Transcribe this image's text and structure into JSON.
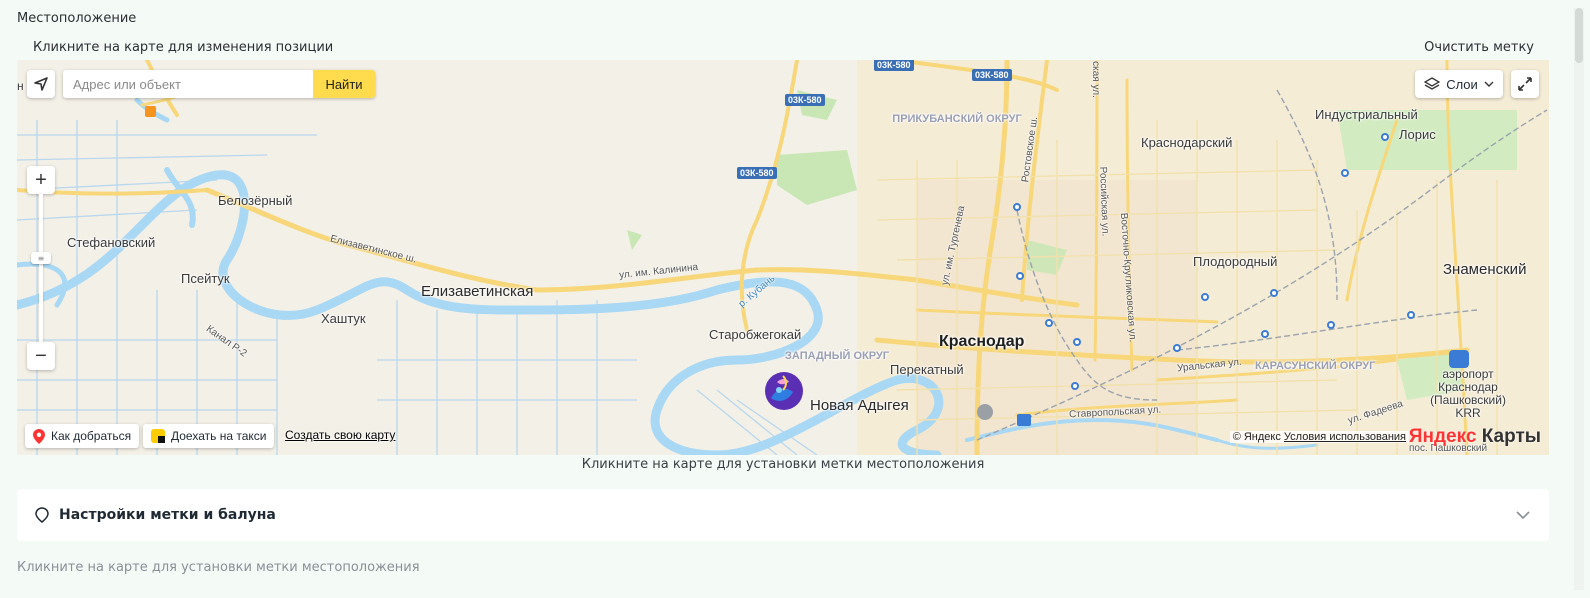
{
  "section_title": "Местоположение",
  "hint_top": "Кликните на карте для изменения позиции",
  "clear_label": "Очистить метку",
  "map": {
    "search_placeholder": "Адрес или объект",
    "search_button": "Найти",
    "layers_label": "Слои",
    "route_label": "Как добраться",
    "taxi_label": "Доехать на такси",
    "create_map_label": "Создать свою карту",
    "copyright": "© Яндекс",
    "terms_label": "Условия использования",
    "logo_ya": "Яндекс",
    "logo_rest": " Карты",
    "partial_top_left": "н",
    "places": {
      "krasnodar": "Краснодар",
      "elizavetinskaya": "Елизаветинская",
      "novaya_adygeya": "Новая Адыгея",
      "belozerny": "Белозёрный",
      "stefanovsky": "Стефановский",
      "pseituk": "Псейтук",
      "khashtuk": "Хаштук",
      "starobzhegokai": "Старобжегокай",
      "perekatny": "Перекатный",
      "krasnodarsky": "Краснодарский",
      "industrialny": "Индустриальный",
      "loris": "Лорис",
      "plodorodny": "Плодородный",
      "znamensky": "Знаменский"
    },
    "districts": {
      "prikubansky": "ПРИКУБАНСКИЙ ОКРУГ",
      "zapadny": "ЗАПАДНЫЙ ОКРУГ",
      "karasunsky": "КАРАСУНСКИЙ ОКРУГ"
    },
    "streets": {
      "elizavetinskoe": "Елизаветинское ш.",
      "kalinina": "ул. им. Калинина",
      "turgeneva": "ул. им. Тургенева",
      "rostovskoe": "Ростовское ш.",
      "rossiyskaya": "Российская ул.",
      "vostochno": "Восточно-Кругликовская ул.",
      "uralskaya": "Уральская ул.",
      "stavropolskaya": "Ставропольская ул.",
      "fadeeva": "ул. Фадеева",
      "kanal": "Канал Р-2",
      "kuban": "р. Кубань",
      "partial_street": "ская ул."
    },
    "road_signs": [
      "03К-580",
      "03К-580",
      "03К-580",
      "03К-580"
    ],
    "airport": "аэропорт Краснодар (Пашковский) KRR",
    "partial_bottom_right": "пос. Пашковский"
  },
  "hint_bottom": "Кликните на карте для установки метки местоположения",
  "settings_label": "Настройки метки и балуна",
  "hint_footer": "Кликните на карте для установки метки местоположения",
  "colors": {
    "page_bg": "#f4faf6",
    "water": "#a9d8f5",
    "road_major": "#f7d77a",
    "search_button": "#ffdb4d",
    "marker": "#5b2fb4"
  }
}
